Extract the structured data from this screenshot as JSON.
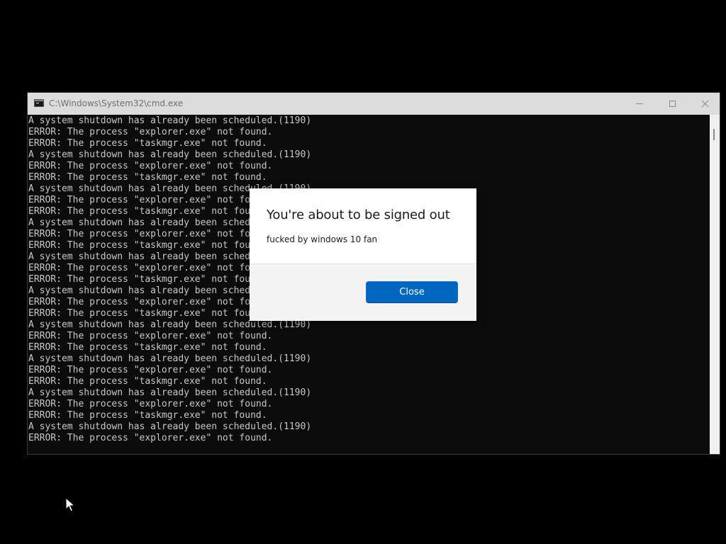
{
  "window": {
    "title": "C:\\Windows\\System32\\cmd.exe",
    "icon": "cmd-icon",
    "controls": [
      "minimize-icon",
      "maximize-icon",
      "close-icon"
    ]
  },
  "console": {
    "text_color": "#c8c8c8",
    "background": "#0c0c0c",
    "lines": [
      "A system shutdown has already been scheduled.(1190)",
      "ERROR: The process \"explorer.exe\" not found.",
      "ERROR: The process \"taskmgr.exe\" not found.",
      "A system shutdown has already been scheduled.(1190)",
      "ERROR: The process \"explorer.exe\" not found.",
      "ERROR: The process \"taskmgr.exe\" not found.",
      "A system shutdown has already been scheduled.(1190)",
      "ERROR: The process \"explorer.exe\" not found.",
      "ERROR: The process \"taskmgr.exe\" not found.",
      "A system shutdown has already been scheduled.(1190)",
      "ERROR: The process \"explorer.exe\" not found.",
      "ERROR: The process \"taskmgr.exe\" not found.",
      "A system shutdown has already been scheduled.(1190)",
      "ERROR: The process \"explorer.exe\" not found.",
      "ERROR: The process \"taskmgr.exe\" not found.",
      "A system shutdown has already been scheduled.(1190)",
      "ERROR: The process \"explorer.exe\" not found.",
      "ERROR: The process \"taskmgr.exe\" not found.",
      "A system shutdown has already been scheduled.(1190)",
      "ERROR: The process \"explorer.exe\" not found.",
      "ERROR: The process \"taskmgr.exe\" not found.",
      "A system shutdown has already been scheduled.(1190)",
      "ERROR: The process \"explorer.exe\" not found.",
      "ERROR: The process \"taskmgr.exe\" not found.",
      "A system shutdown has already been scheduled.(1190)",
      "ERROR: The process \"explorer.exe\" not found.",
      "ERROR: The process \"taskmgr.exe\" not found.",
      "A system shutdown has already been scheduled.(1190)",
      "ERROR: The process \"explorer.exe\" not found."
    ]
  },
  "dialog": {
    "title": "You're about to be signed out",
    "message": "fucked by windows 10 fan",
    "button_label": "Close",
    "button_color": "#0067c0"
  },
  "cursor": {
    "icon": "arrow-cursor-icon"
  }
}
